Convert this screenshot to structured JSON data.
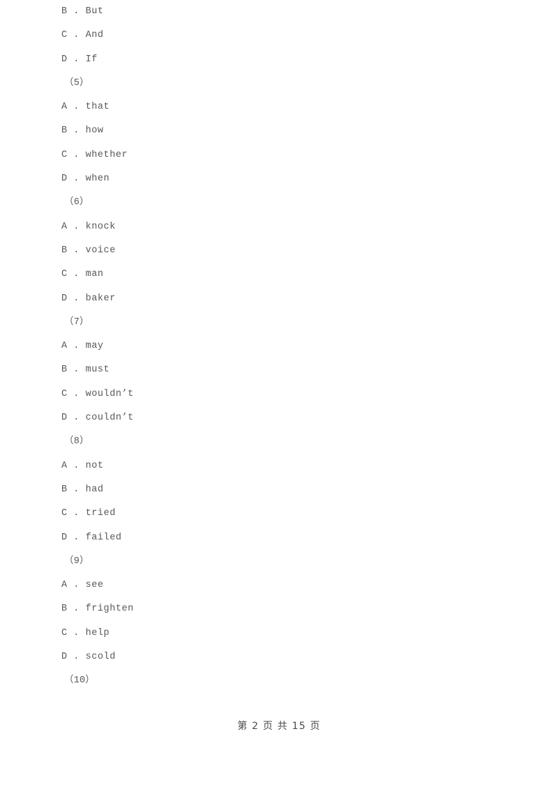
{
  "document": {
    "page_background": "#ffffff",
    "text_color": "#585858",
    "lines": [
      {
        "kind": "option",
        "text": "B . But"
      },
      {
        "kind": "option",
        "text": "C . And"
      },
      {
        "kind": "option",
        "text": "D . If"
      },
      {
        "kind": "question",
        "text": "（5）"
      },
      {
        "kind": "option",
        "text": "A . that"
      },
      {
        "kind": "option",
        "text": "B . how"
      },
      {
        "kind": "option",
        "text": "C . whether"
      },
      {
        "kind": "option",
        "text": "D . when"
      },
      {
        "kind": "question",
        "text": "（6）"
      },
      {
        "kind": "option",
        "text": "A . knock"
      },
      {
        "kind": "option",
        "text": "B . voice"
      },
      {
        "kind": "option",
        "text": "C . man"
      },
      {
        "kind": "option",
        "text": "D . baker"
      },
      {
        "kind": "question",
        "text": "（7）"
      },
      {
        "kind": "option",
        "text": "A . may"
      },
      {
        "kind": "option",
        "text": "B . must"
      },
      {
        "kind": "option",
        "text": "C . wouldn’t"
      },
      {
        "kind": "option",
        "text": "D . couldn’t"
      },
      {
        "kind": "question",
        "text": "（8）"
      },
      {
        "kind": "option",
        "text": "A . not"
      },
      {
        "kind": "option",
        "text": "B . had"
      },
      {
        "kind": "option",
        "text": "C . tried"
      },
      {
        "kind": "option",
        "text": "D . failed"
      },
      {
        "kind": "question",
        "text": "（9）"
      },
      {
        "kind": "option",
        "text": "A . see"
      },
      {
        "kind": "option",
        "text": "B . frighten"
      },
      {
        "kind": "option",
        "text": "C . help"
      },
      {
        "kind": "option",
        "text": "D . scold"
      },
      {
        "kind": "question",
        "text": "（10）"
      }
    ],
    "footer": {
      "text": "第 2 页 共 15 页",
      "current_page": "2",
      "total_pages": "15"
    }
  }
}
